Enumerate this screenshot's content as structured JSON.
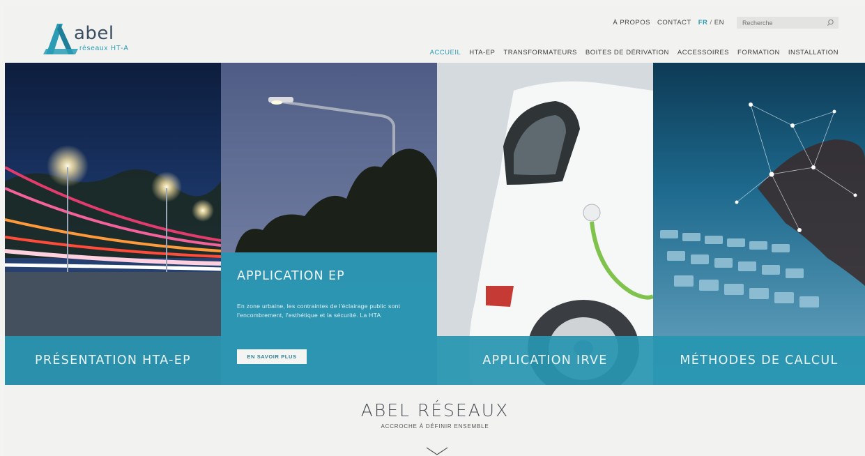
{
  "brand": {
    "name": "abel",
    "subtitle": "réseaux HT-A"
  },
  "topbar": {
    "about": "À PROPOS",
    "contact": "CONTACT",
    "lang_fr": "FR",
    "lang_sep": "/",
    "lang_en": "EN",
    "search_placeholder": "Recherche"
  },
  "nav": {
    "items": [
      {
        "label": "ACCUEIL",
        "active": true
      },
      {
        "label": "HTA-EP"
      },
      {
        "label": "TRANSFORMATEURS"
      },
      {
        "label": "BOITES DE DÉRIVATION"
      },
      {
        "label": "ACCESSOIRES"
      },
      {
        "label": "FORMATION"
      },
      {
        "label": "INSTALLATION"
      }
    ]
  },
  "hero": {
    "panels": [
      {
        "label": "PRÉSENTATION HTA-EP"
      },
      {
        "title": "APPLICATION EP",
        "text": "En zone urbaine, les contraintes de l'éclairage public sont l'encombrement, l'esthétique et la sécurité. La HTA",
        "button": "EN SAVOIR PLUS"
      },
      {
        "label": "APPLICATION IRVE"
      },
      {
        "label": "MÉTHODES DE CALCUL"
      }
    ]
  },
  "section": {
    "title": "ABEL RÉSEAUX",
    "tagline": "ACCROCHE À DÉFINIR ENSEMBLE"
  },
  "colors": {
    "accent": "#2c9cb5",
    "band": "#2896b2",
    "background": "#f2f2f0"
  }
}
